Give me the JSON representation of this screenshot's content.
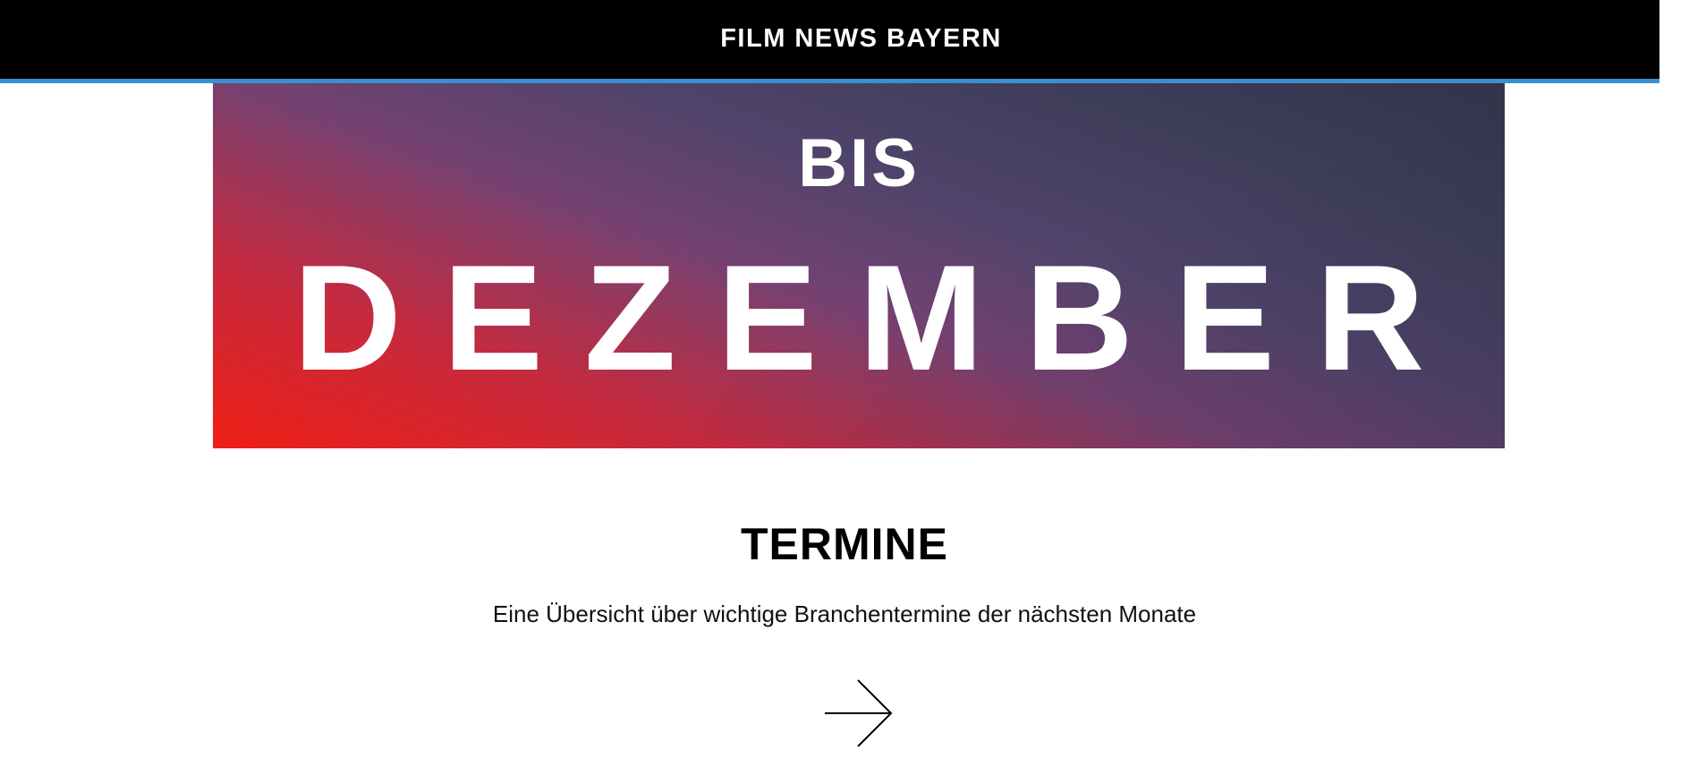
{
  "header": {
    "site_title": "FILM NEWS BAYERN"
  },
  "hero": {
    "line1": "BIS",
    "line2": "DEZEMBER"
  },
  "section": {
    "title": "TERMINE",
    "subtitle": "Eine Übersicht über wichtige Branchentermine der nächsten Monate",
    "arrow_icon": "arrow-right-icon"
  },
  "colors": {
    "header_bg": "#000000",
    "accent_line": "#3a8fd0",
    "hero_gradient": [
      "#ee1d14",
      "#6e3e6c",
      "#303046"
    ]
  }
}
